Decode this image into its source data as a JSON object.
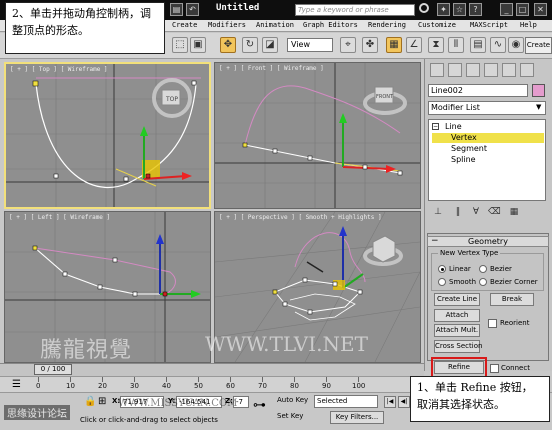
{
  "window": {
    "title": "Untitled",
    "search_placeholder": "Type a keyword or phrase",
    "menus": [
      "Create",
      "Modifiers",
      "Animation",
      "Graph Editors",
      "Rendering",
      "Customize",
      "MAXScript",
      "Help"
    ]
  },
  "toolbar": {
    "view_dropdown": "View",
    "create_button": "Create"
  },
  "viewports": {
    "top": "[ + ] [ Top ] [ Wireframe ]",
    "front": "[ + ] [ Front ] [ Wireframe ]",
    "left": "[ + ] [ Left ] [ Wireframe ]",
    "perspective": "[ + ] [ Perspective ] [ Smooth + Highlights ]",
    "cube_top": "TOP",
    "cube_front": "FRONT"
  },
  "command_panel": {
    "object_name": "Line002",
    "object_color": "#e49ccd",
    "modifier_list": "Modifier List",
    "stack": {
      "root": "Line",
      "items": [
        "Vertex",
        "Segment",
        "Spline"
      ],
      "selected": "Vertex"
    },
    "geometry": {
      "title": "Geometry",
      "new_vertex_type": "New Vertex Type",
      "radios": [
        "Linear",
        "Bezier",
        "Smooth",
        "Bezier Corner"
      ],
      "selected_radio": "Linear",
      "buttons": {
        "create_line": "Create Line",
        "break": "Break",
        "attach": "Attach",
        "reorient": "Reorient",
        "attach_mult": "Attach Mult.",
        "cross_section": "Cross Section",
        "refine": "Refine",
        "connect": "Connect"
      }
    }
  },
  "timeline": {
    "frame": "0 / 100",
    "ticks": [
      "0",
      "10",
      "20",
      "30",
      "40",
      "50",
      "60",
      "70",
      "80",
      "90",
      "100"
    ]
  },
  "status": {
    "x_label": "X:",
    "x_value": "71.917",
    "y_label": "Y:",
    "y_value": "-164.541",
    "z_label": "Z:",
    "z_value": "-7",
    "auto_key": "Auto Key",
    "set_key": "Set Key",
    "selected": "Selected",
    "key_filters": "Key Filters...",
    "prompt": "Click or click-and-drag to select objects"
  },
  "callouts": {
    "step2": "2、单击并拖动角控制柄，调整顶点的形态。",
    "step1": "1、单击 Refine 按钮，取消其选择状态。"
  },
  "watermarks": {
    "main": "騰龍視覺",
    "url": "WWW.TLVI.NET",
    "small": "WWW.MISSYUAN.COM",
    "corner": "思缘设计论坛"
  }
}
